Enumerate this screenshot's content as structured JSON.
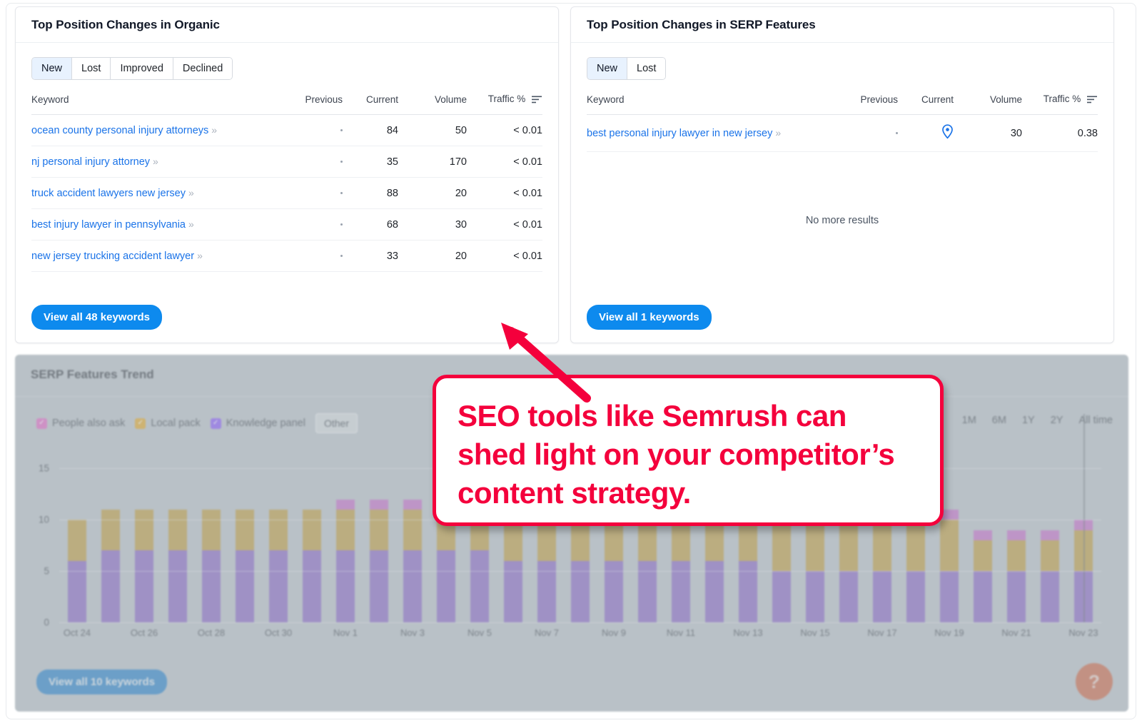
{
  "organic_card": {
    "title": "Top Position Changes in Organic",
    "tabs": [
      {
        "label": "New",
        "active": true
      },
      {
        "label": "Lost",
        "active": false
      },
      {
        "label": "Improved",
        "active": false
      },
      {
        "label": "Declined",
        "active": false
      }
    ],
    "columns": [
      "Keyword",
      "Previous",
      "Current",
      "Volume",
      "Traffic %"
    ],
    "sort_icon": "sort-descending-icon",
    "rows": [
      {
        "keyword": "ocean county personal injury attorneys",
        "previous": "·",
        "current": "84",
        "volume": "50",
        "traffic": "< 0.01"
      },
      {
        "keyword": "nj personal injury attorney",
        "previous": "·",
        "current": "35",
        "volume": "170",
        "traffic": "< 0.01"
      },
      {
        "keyword": "truck accident lawyers new jersey",
        "previous": "·",
        "current": "88",
        "volume": "20",
        "traffic": "< 0.01"
      },
      {
        "keyword": "best injury lawyer in pennsylvania",
        "previous": "·",
        "current": "68",
        "volume": "30",
        "traffic": "< 0.01"
      },
      {
        "keyword": "new jersey trucking accident lawyer",
        "previous": "·",
        "current": "33",
        "volume": "20",
        "traffic": "< 0.01"
      }
    ],
    "view_all_label": "View all 48 keywords"
  },
  "serp_card": {
    "title": "Top Position Changes in SERP Features",
    "tabs": [
      {
        "label": "New",
        "active": true
      },
      {
        "label": "Lost",
        "active": false
      }
    ],
    "columns": [
      "Keyword",
      "Previous",
      "Current",
      "Volume",
      "Traffic %"
    ],
    "sort_icon": "sort-descending-icon",
    "rows": [
      {
        "keyword": "best personal injury lawyer in new jersey",
        "previous": "·",
        "current_icon": "map-pin-icon",
        "volume": "30",
        "traffic": "0.38"
      }
    ],
    "empty_text": "No more results",
    "view_all_label": "View all 1 keywords"
  },
  "trend_panel": {
    "title": "SERP Features Trend",
    "legend": [
      {
        "label": "People also ask",
        "color": "#e06bc3",
        "checked": true
      },
      {
        "label": "Local pack",
        "color": "#e0a82e",
        "checked": true
      },
      {
        "label": "Knowledge panel",
        "color": "#8b5cf6",
        "checked": true
      }
    ],
    "more_label": "Other",
    "ranges": [
      "1M",
      "6M",
      "1Y",
      "2Y",
      "All time"
    ],
    "view_all_label": "View all 10 keywords",
    "help_label": "?"
  },
  "callout": {
    "text": "SEO tools like Semrush can shed light on your competitor’s content strategy.",
    "color": "#f4003c"
  },
  "chart_data": {
    "type": "bar",
    "title": "SERP Features Trend",
    "xlabel": "",
    "ylabel": "",
    "ylim": [
      0,
      16
    ],
    "yticks": [
      0,
      5,
      10,
      15
    ],
    "grid": true,
    "legend_position": "top-left",
    "stacked": true,
    "categories": [
      "Oct 24",
      "Oct 25",
      "Oct 26",
      "Oct 27",
      "Oct 28",
      "Oct 29",
      "Oct 30",
      "Oct 31",
      "Nov 1",
      "Nov 2",
      "Nov 3",
      "Nov 4",
      "Nov 5",
      "Nov 6",
      "Nov 7",
      "Nov 8",
      "Nov 9",
      "Nov 10",
      "Nov 11",
      "Nov 12",
      "Nov 13",
      "Nov 14",
      "Nov 15",
      "Nov 16",
      "Nov 17",
      "Nov 18",
      "Nov 19",
      "Nov 20",
      "Nov 21",
      "Nov 22",
      "Nov 23"
    ],
    "tick_labels": [
      "Oct 24",
      "",
      "Oct 26",
      "",
      "Oct 28",
      "",
      "Oct 30",
      "",
      "Nov 1",
      "",
      "Nov 3",
      "",
      "Nov 5",
      "",
      "Nov 7",
      "",
      "Nov 9",
      "",
      "Nov 11",
      "",
      "Nov 13",
      "",
      "Nov 15",
      "",
      "Nov 17",
      "",
      "Nov 19",
      "",
      "Nov 21",
      "",
      "Nov 23"
    ],
    "series": [
      {
        "name": "Knowledge panel",
        "color": "#8b6bc4",
        "values": [
          6,
          7,
          7,
          7,
          7,
          7,
          7,
          7,
          7,
          7,
          7,
          7,
          7,
          6,
          6,
          6,
          6,
          6,
          6,
          6,
          6,
          5,
          5,
          5,
          5,
          5,
          5,
          5,
          5,
          5,
          5
        ]
      },
      {
        "name": "Local pack",
        "color": "#bd9d46",
        "values": [
          4,
          4,
          4,
          4,
          4,
          4,
          4,
          4,
          4,
          4,
          4,
          5,
          5,
          5,
          5,
          5,
          5,
          5,
          5,
          5,
          5,
          6,
          6,
          6,
          6,
          6,
          5,
          3,
          3,
          3,
          4
        ]
      },
      {
        "name": "People also ask",
        "color": "#c371c7",
        "values": [
          0,
          0,
          0,
          0,
          0,
          0,
          0,
          0,
          1,
          1,
          1,
          1,
          0,
          0,
          0,
          0,
          0,
          0,
          0,
          0,
          0,
          0,
          0,
          0,
          0,
          1,
          1,
          1,
          1,
          1,
          1
        ]
      }
    ],
    "hover_index": 30
  }
}
